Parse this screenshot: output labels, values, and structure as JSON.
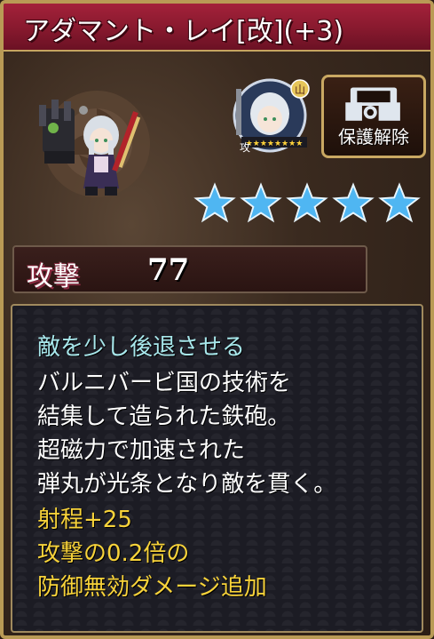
{
  "title": "アダマント・レイ[改](+3)",
  "lock_button": {
    "label": "保護解除",
    "icon": "lock-icon"
  },
  "unit_icon": {
    "badge": "山",
    "star_row": "★★★★★★★★",
    "type_label": "攻"
  },
  "rarity": {
    "stars": 5,
    "color": "#4fb6f2"
  },
  "stat": {
    "label": "攻撃",
    "value": "77"
  },
  "description": {
    "colors": {
      "heading": "#a8e8ec",
      "body": "#ffffff",
      "effect": "#f8d33a"
    },
    "lines": [
      {
        "text": "敵を少し後退させる",
        "kind": "heading"
      },
      {
        "text": "バルニバービ国の技術を",
        "kind": "body"
      },
      {
        "text": "結集して造られた鉄砲。",
        "kind": "body"
      },
      {
        "text": "超磁力で加速された",
        "kind": "body"
      },
      {
        "text": "弾丸が光条となり敵を貫く。",
        "kind": "body"
      },
      {
        "text": "射程+25",
        "kind": "effect"
      },
      {
        "text": "攻撃の0.2倍の",
        "kind": "effect"
      },
      {
        "text": "防御無効ダメージ追加",
        "kind": "effect"
      }
    ]
  }
}
